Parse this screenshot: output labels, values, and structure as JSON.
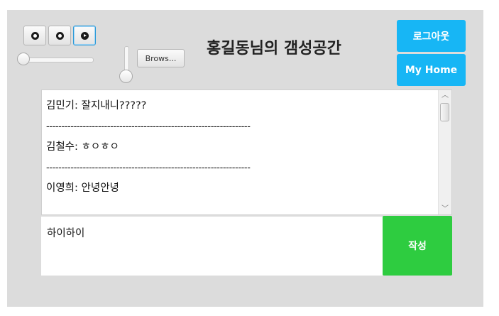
{
  "header": {
    "title": "홍길동님의 갬성공간",
    "logout_label": "로그아웃",
    "home_label": "My Home"
  },
  "media": {
    "buttons": [
      {
        "icon": "stop-icon"
      },
      {
        "icon": "pause-icon"
      },
      {
        "icon": "play-icon",
        "active": true
      }
    ],
    "browse_label": "Brows..."
  },
  "chat": {
    "messages": [
      "김민기: 잘지내니?????",
      "-------------------------------------------------------------------",
      "김철수: ㅎㅇㅎㅇ",
      "-------------------------------------------------------------------",
      "이영희: 안녕안녕"
    ]
  },
  "composer": {
    "input_value": "하이하이",
    "submit_label": "작성"
  },
  "colors": {
    "accent_blue": "#17b6f5",
    "submit_green": "#2ecc40",
    "panel_bg": "#dcdcdc"
  }
}
